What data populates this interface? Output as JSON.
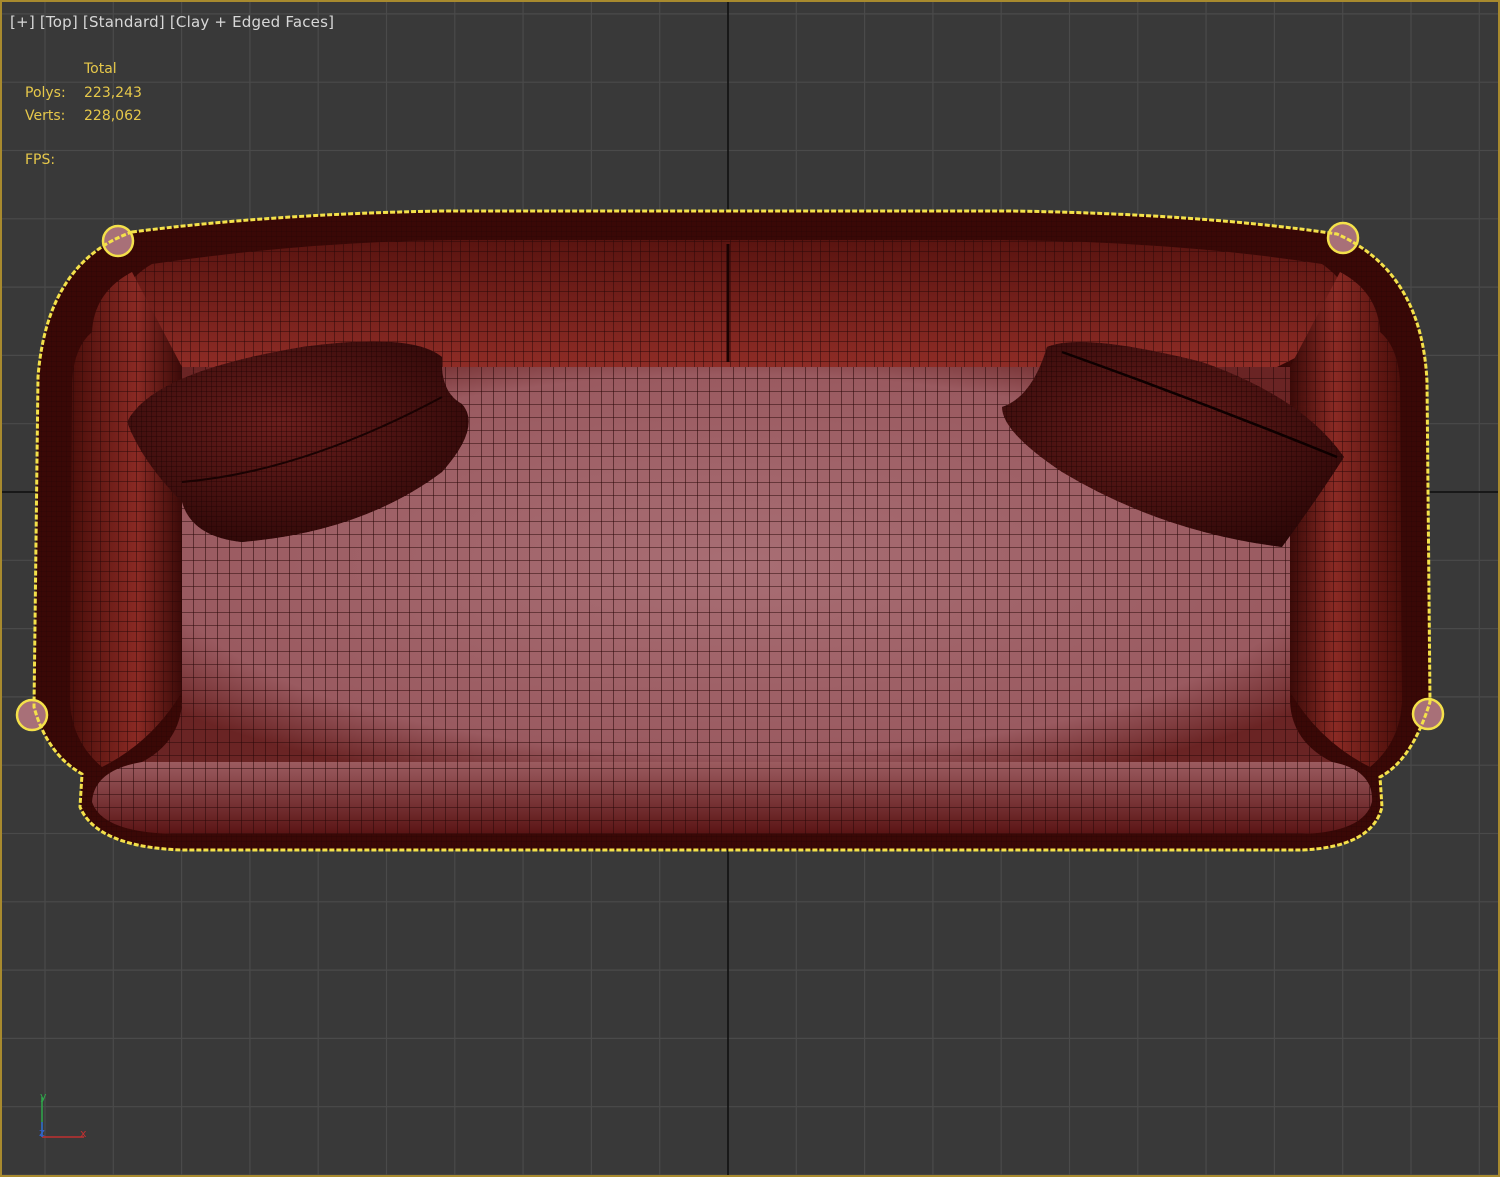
{
  "viewport": {
    "labels": [
      "[+]",
      "[Top]",
      "[Standard]",
      "[Clay + Edged Faces]"
    ],
    "stats": {
      "header": "Total",
      "polys_label": "Polys:",
      "polys_value": "223,243",
      "verts_label": "Verts:",
      "verts_value": "228,062",
      "fps_label": "FPS:"
    },
    "axis": {
      "y": "y",
      "x": "x",
      "z": "z"
    }
  },
  "colors": {
    "background": "#393939",
    "grid": "#4a4a4a",
    "selection": "#f4e14a",
    "active_border": "#a88a2e",
    "sofa_seat": "#a46a70",
    "sofa_frame": "#8a2a24",
    "mesh_lines": "#2a0808",
    "stats_text": "#e6c84a"
  }
}
